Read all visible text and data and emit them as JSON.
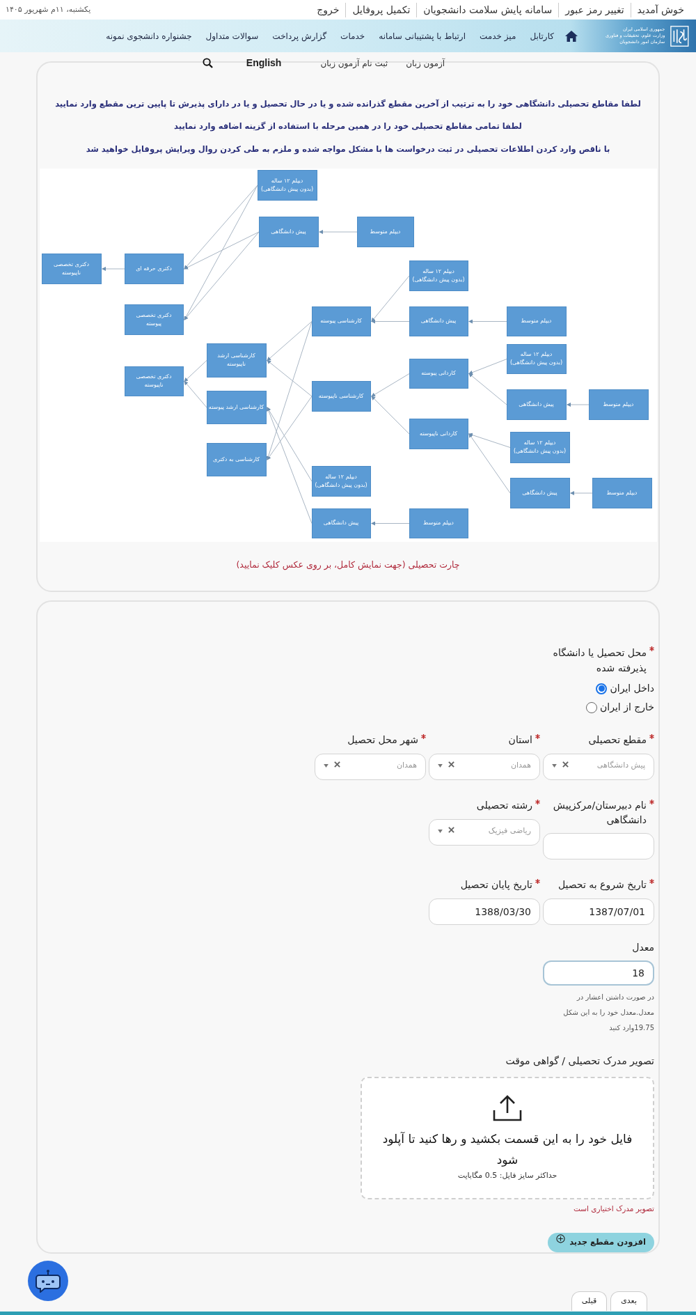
{
  "top_bar": {
    "links": [
      "خوش آمدید",
      "تغییر رمز عبور",
      "سامانه پایش سلامت دانشجویان",
      "تکمیل پروفایل",
      "خروج"
    ],
    "date": "یکشنبه، ۱۱م شهریور ۱۴۰۵"
  },
  "logo": {
    "lines": [
      "جمهوری اسلامی ایران",
      "وزارت علوم، تحقیقات و فناوری",
      "سازمان امور دانشجویان"
    ]
  },
  "nav": {
    "items": [
      "کارتابل",
      "میز خدمت",
      "ارتباط با پشتیبانی سامانه",
      "خدمات",
      "گزارش پرداخت",
      "سوالات متداول",
      "جشنواره دانشجوی نمونه"
    ]
  },
  "sub_nav": {
    "links": [
      "آزمون زبان",
      "ثبت نام آزمون زبان"
    ],
    "language": "English"
  },
  "instructions": [
    "لطفا مقاطع تحصیلی دانشگاهی خود را به ترتیب از آخرین مقطع گذرانده شده و یا در حال تحصیل و یا در دارای پذیرش تا پایین ترین مقطع وارد نمایید",
    "لطفا تمامی مقاطع تحصیلی خود را در همین مرحله با استفاده از گزینه اضافه وارد نمایید",
    "با ناقص وارد کردن اطلاعات تحصیلی در ثبت درخواست ها با مشکل مواجه شده و ملزم به طی کردن روال ویرایش پروفایل خواهید شد"
  ],
  "diagram": {
    "nodes": [
      {
        "label": "دیپلم ۱۲ ساله\n(بدون پیش دانشگاهی)"
      },
      {
        "label": "دیپلم متوسط"
      },
      {
        "label": "پیش دانشگاهی"
      },
      {
        "label": "دکتری حرفه ای"
      },
      {
        "label": "دکتری تخصصی\nناپیوسته"
      },
      {
        "label": "دیپلم ۱۲ ساله\n(بدون پیش دانشگاهی)"
      },
      {
        "label": "دیپلم متوسط"
      },
      {
        "label": "پیش دانشگاهی"
      },
      {
        "label": "کارشناسی پیوسته"
      },
      {
        "label": "دکتری تخصصی\nپیوسته"
      },
      {
        "label": "دیپلم ۱۲ ساله\n(بدون پیش دانشگاهی)"
      },
      {
        "label": "کارشناسی ارشد\nناپیوسته"
      },
      {
        "label": "کاردانی پیوسته"
      },
      {
        "label": "دکتری تخصصی\nناپیوسته"
      },
      {
        "label": "کارشناسی ناپیوسته"
      },
      {
        "label": "دیپلم متوسط"
      },
      {
        "label": "پیش دانشگاهی"
      },
      {
        "label": "کارشناسی ارشد پیوسته"
      },
      {
        "label": "کاردانی ناپیوسته"
      },
      {
        "label": "دیپلم ۱۲ ساله\n(بدون پیش دانشگاهی)"
      },
      {
        "label": "کارشناسی به دکتری"
      },
      {
        "label": "دیپلم ۱۲ ساله\n(بدون پیش دانشگاهی)"
      },
      {
        "label": "دیپلم متوسط"
      },
      {
        "label": "پیش دانشگاهی"
      },
      {
        "label": "دیپلم متوسط"
      },
      {
        "label": "پیش دانشگاهی"
      }
    ],
    "caption": "چارت تحصیلی (جهت نمایش کامل، بر روی عکس کلیک نمایید)"
  },
  "form": {
    "place": {
      "label": "محل تحصیل یا دانشگاه پذیرفته شده",
      "required": true,
      "options": [
        {
          "label": "داخل ایران",
          "selected": true
        },
        {
          "label": "خارج از ایران",
          "selected": false
        }
      ]
    },
    "row1": [
      {
        "kind": "select",
        "label": "مقطع تحصیلی",
        "required": true,
        "value": "پیش دانشگاهی"
      },
      {
        "kind": "select",
        "label": "استان",
        "required": true,
        "value": "همدان"
      },
      {
        "kind": "select",
        "label": "شهر محل تحصیل",
        "required": true,
        "value": "همدان"
      }
    ],
    "row2": [
      {
        "kind": "text",
        "label": "نام دبیرستان/مرکزپیش دانشگاهی",
        "required": true
      },
      {
        "kind": "select",
        "label": "رشته تحصیلی",
        "required": true,
        "value": "ریاضی فیزیک"
      }
    ],
    "row3": [
      {
        "kind": "text",
        "label": "تاریخ شروع به تحصیل",
        "required": true,
        "value": "1387/07/01"
      },
      {
        "kind": "text",
        "label": "تاریخ پایان تحصیل",
        "required": true,
        "value": "1388/03/30"
      }
    ],
    "average": {
      "label": "معدل",
      "value": "18",
      "help": "در صورت داشتن اعشار در معدل.معدل خود را به این شکل 19.75وارد کنید"
    },
    "upload": {
      "label": "تصویر مدرک تحصیلی / گواهی موقت",
      "prompt": "فایل خود را به این قسمت بکشید و رها کنید تا آپلود شود",
      "limit": "حداکثر سایز فایل: 0.5 مگابایت",
      "note": "تصویر مدرک اختیاری است"
    },
    "add_button": "افزودن مقطع جدید"
  },
  "footer": {
    "buttons": [
      "بعدی",
      "قبلی"
    ]
  }
}
